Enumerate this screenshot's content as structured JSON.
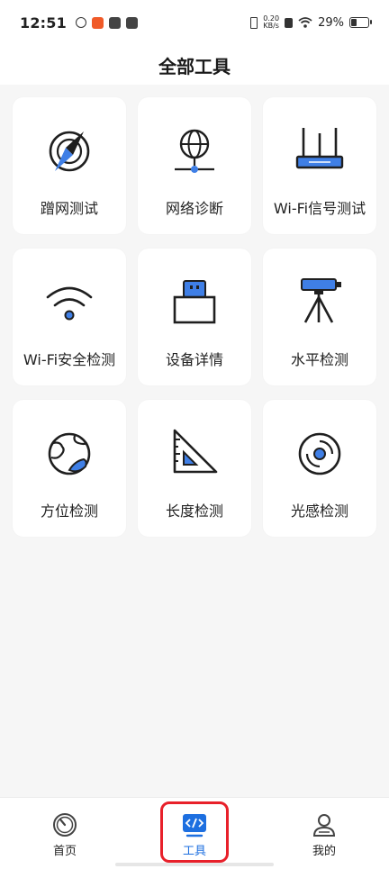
{
  "status_bar": {
    "time": "12:51",
    "net_speed_value": "0.20",
    "net_speed_unit": "KB/s",
    "battery": "29%"
  },
  "page_title": "全部工具",
  "tools": [
    {
      "label": "蹭网测试",
      "icon": "compass-icon"
    },
    {
      "label": "网络诊断",
      "icon": "globe-network-icon"
    },
    {
      "label": "Wi-Fi信号测试",
      "icon": "router-icon"
    },
    {
      "label": "Wi-Fi安全检测",
      "icon": "wifi-icon"
    },
    {
      "label": "设备详情",
      "icon": "device-icon"
    },
    {
      "label": "水平检测",
      "icon": "level-tripod-icon"
    },
    {
      "label": "方位检测",
      "icon": "globe-icon"
    },
    {
      "label": "长度检测",
      "icon": "ruler-icon"
    },
    {
      "label": "光感检测",
      "icon": "light-sensor-icon"
    }
  ],
  "tabs": [
    {
      "label": "首页",
      "icon": "speedometer-icon",
      "active": false
    },
    {
      "label": "工具",
      "icon": "code-icon",
      "active": true
    },
    {
      "label": "我的",
      "icon": "user-icon",
      "active": false
    }
  ],
  "colors": {
    "accent": "#1d6fe0",
    "highlight": "#e8202a"
  }
}
